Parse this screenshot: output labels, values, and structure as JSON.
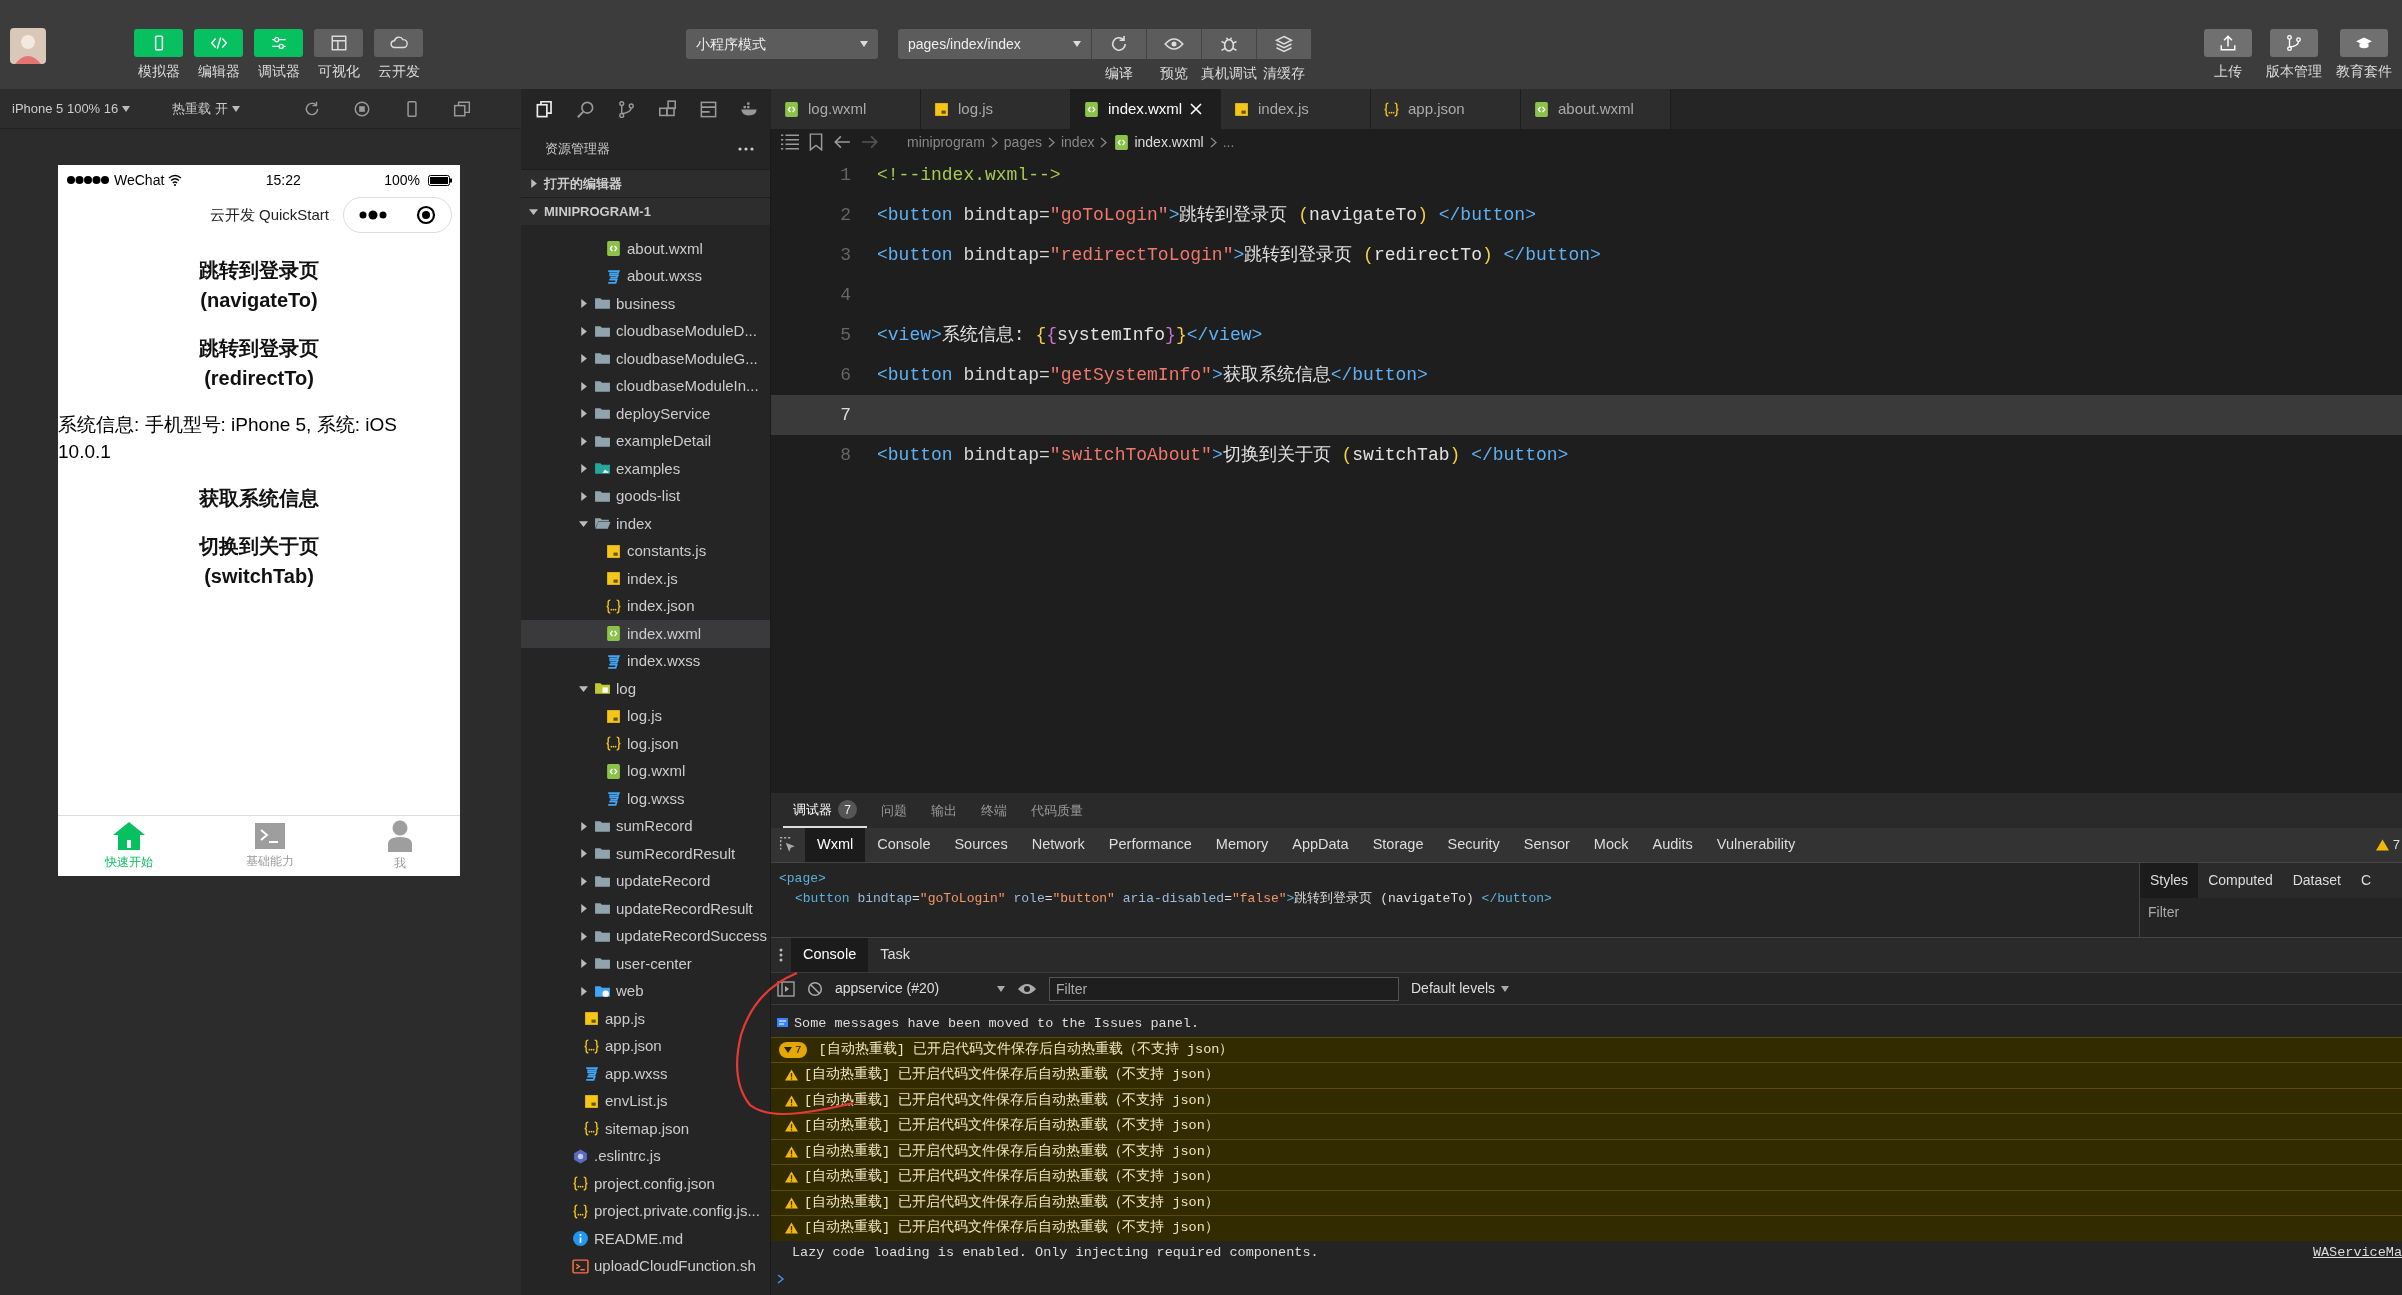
{
  "toolbar": {
    "view_buttons": [
      {
        "label": "模拟器",
        "on": true
      },
      {
        "label": "编辑器",
        "on": true
      },
      {
        "label": "调试器",
        "on": true
      },
      {
        "label": "可视化",
        "on": false
      },
      {
        "label": "云开发",
        "on": false
      }
    ],
    "mode_select": "小程序模式",
    "page_select": "pages/index/index",
    "action_buttons": [
      "编译",
      "预览",
      "真机调试",
      "清缓存"
    ],
    "right_buttons": [
      "上传",
      "版本管理",
      "教育套件"
    ]
  },
  "simulator_bar": {
    "device": "iPhone 5 100% 16",
    "hot_reload": "热重载 开"
  },
  "editor_tabs": [
    {
      "label": "log.wxml",
      "kind": "wxml",
      "selected": false
    },
    {
      "label": "log.js",
      "kind": "js",
      "selected": false
    },
    {
      "label": "index.wxml",
      "kind": "wxml",
      "selected": true
    },
    {
      "label": "index.js",
      "kind": "js",
      "selected": false
    },
    {
      "label": "app.json",
      "kind": "json",
      "selected": false
    },
    {
      "label": "about.wxml",
      "kind": "wxml",
      "selected": false
    }
  ],
  "breadcrumb": [
    {
      "label": "miniprogram",
      "kind": "dir"
    },
    {
      "label": "pages",
      "kind": "dir"
    },
    {
      "label": "index",
      "kind": "dir"
    },
    {
      "label": "index.wxml",
      "kind": "wxml"
    },
    {
      "label": "...",
      "kind": "dir"
    }
  ],
  "code": [
    {
      "number": "1",
      "current": false,
      "tokens": [
        {
          "kind": "comment",
          "text": "<!--index.wxml-->"
        }
      ]
    },
    {
      "number": "2",
      "current": false,
      "tokens": [
        {
          "kind": "tag",
          "text": "<button"
        },
        {
          "kind": "attr",
          "text": " bindtap="
        },
        {
          "kind": "string",
          "text": "\"goToLogin\""
        },
        {
          "kind": "tag",
          "text": ">"
        },
        {
          "kind": "text",
          "text": "跳转到登录页 "
        },
        {
          "kind": "paren",
          "text": "("
        },
        {
          "kind": "text",
          "text": "navigateTo"
        },
        {
          "kind": "paren",
          "text": ")"
        },
        {
          "kind": "tag",
          "text": " </button>"
        }
      ]
    },
    {
      "number": "3",
      "current": false,
      "tokens": [
        {
          "kind": "tag",
          "text": "<button"
        },
        {
          "kind": "attr",
          "text": " bindtap="
        },
        {
          "kind": "string",
          "text": "\"redirectToLogin\""
        },
        {
          "kind": "tag",
          "text": ">"
        },
        {
          "kind": "text",
          "text": "跳转到登录页 "
        },
        {
          "kind": "paren",
          "text": "("
        },
        {
          "kind": "text",
          "text": "redirectTo"
        },
        {
          "kind": "paren",
          "text": ")"
        },
        {
          "kind": "tag",
          "text": " </button>"
        }
      ]
    },
    {
      "number": "4",
      "current": false
    },
    {
      "number": "5",
      "current": false,
      "tokens": [
        {
          "kind": "tag",
          "text": "<view>"
        },
        {
          "kind": "text",
          "text": "系统信息: "
        },
        {
          "kind": "paren",
          "text": "{"
        },
        {
          "kind": "brace",
          "text": "{"
        },
        {
          "kind": "text",
          "text": "systemInfo"
        },
        {
          "kind": "brace",
          "text": "}"
        },
        {
          "kind": "paren",
          "text": "}"
        },
        {
          "kind": "tag",
          "text": "</view>"
        }
      ]
    },
    {
      "number": "6",
      "current": false,
      "tokens": [
        {
          "kind": "tag",
          "text": "<button"
        },
        {
          "kind": "attr",
          "text": " bindtap="
        },
        {
          "kind": "string",
          "text": "\"getSystemInfo\""
        },
        {
          "kind": "tag",
          "text": ">"
        },
        {
          "kind": "text",
          "text": "获取系统信息"
        },
        {
          "kind": "tag",
          "text": "</button>"
        }
      ]
    },
    {
      "number": "7",
      "current": true
    },
    {
      "number": "8",
      "current": false,
      "tokens": [
        {
          "kind": "tag",
          "text": "<button"
        },
        {
          "kind": "attr",
          "text": " bindtap="
        },
        {
          "kind": "string",
          "text": "\"switchToAbout\""
        },
        {
          "kind": "tag",
          "text": ">"
        },
        {
          "kind": "text",
          "text": "切换到关于页 "
        },
        {
          "kind": "paren",
          "text": "("
        },
        {
          "kind": "text",
          "text": "switchTab"
        },
        {
          "kind": "paren",
          "text": ")"
        },
        {
          "kind": "tag",
          "text": " </button>"
        }
      ]
    }
  ],
  "phone": {
    "carrier": "WeChat",
    "time": "15:22",
    "battery": "100%",
    "title": "云开发 QuickStart",
    "content": [
      {
        "kind": "button",
        "text": "跳转到登录页 (navigateTo)"
      },
      {
        "kind": "button",
        "text": "跳转到登录页 (redirectTo)"
      },
      {
        "kind": "text",
        "text": "系统信息: 手机型号: iPhone 5, 系统: iOS 10.0.1"
      },
      {
        "kind": "button",
        "text": "获取系统信息"
      },
      {
        "kind": "button",
        "text": "切换到关于页 (switchTab)"
      }
    ],
    "tabbar": [
      {
        "label": "快速开始",
        "selected": true
      },
      {
        "label": "基础能力",
        "selected": false
      },
      {
        "label": "我",
        "selected": false
      }
    ]
  },
  "explorer": {
    "title": "资源管理器",
    "sections": [
      {
        "label": "打开的编辑器",
        "expanded": false
      },
      {
        "label": "MINIPROGRAM-1",
        "expanded": true
      }
    ],
    "tree": [
      {
        "children": [
          {
            "children": [
              {
                "children": [
                  {
                    "label": "about.wxml",
                    "kind": "wxml",
                    "selected": false
                  },
                  {
                    "label": "about.wxss",
                    "kind": "wxss",
                    "selected": false
                  }
                ]
              },
              {
                "label": "business",
                "kind": "folder",
                "expanded": false,
                "selected": false
              },
              {
                "label": "cloudbaseModuleD...",
                "kind": "folder",
                "expanded": false,
                "selected": false
              },
              {
                "label": "cloudbaseModuleG...",
                "kind": "folder",
                "expanded": false,
                "selected": false
              },
              {
                "label": "cloudbaseModuleIn...",
                "kind": "folder",
                "expanded": false,
                "selected": false
              },
              {
                "label": "deployService",
                "kind": "folder",
                "expanded": false,
                "selected": false
              },
              {
                "label": "exampleDetail",
                "kind": "folder",
                "expanded": false,
                "selected": false
              },
              {
                "label": "examples",
                "kind": "folder-image",
                "expanded": false,
                "selected": false
              },
              {
                "label": "goods-list",
                "kind": "folder",
                "expanded": false,
                "selected": false
              },
              {
                "label": "index",
                "kind": "folder",
                "expanded": true,
                "selected": false,
                "children": [
                  {
                    "label": "constants.js",
                    "kind": "js",
                    "selected": false
                  },
                  {
                    "label": "index.js",
                    "kind": "js",
                    "selected": false
                  },
                  {
                    "label": "index.json",
                    "kind": "json",
                    "selected": false
                  },
                  {
                    "label": "index.wxml",
                    "kind": "wxml",
                    "selected": true
                  },
                  {
                    "label": "index.wxss",
                    "kind": "wxss",
                    "selected": false
                  }
                ]
              },
              {
                "label": "log",
                "kind": "folder-log",
                "expanded": true,
                "selected": false,
                "children": [
                  {
                    "label": "log.js",
                    "kind": "js",
                    "selected": false
                  },
                  {
                    "label": "log.json",
                    "kind": "json",
                    "selected": false
                  },
                  {
                    "label": "log.wxml",
                    "kind": "wxml",
                    "selected": false
                  },
                  {
                    "label": "log.wxss",
                    "kind": "wxss",
                    "selected": false
                  }
                ]
              },
              {
                "label": "sumRecord",
                "kind": "folder",
                "expanded": false,
                "selected": false
              },
              {
                "label": "sumRecordResult",
                "kind": "folder",
                "expanded": false,
                "selected": false
              },
              {
                "label": "updateRecord",
                "kind": "folder",
                "expanded": false,
                "selected": false
              },
              {
                "label": "updateRecordResult",
                "kind": "folder",
                "expanded": false,
                "selected": false
              },
              {
                "label": "updateRecordSuccess",
                "kind": "folder",
                "expanded": false,
                "selected": false
              },
              {
                "label": "user-center",
                "kind": "folder",
                "expanded": false,
                "selected": false
              },
              {
                "label": "web",
                "kind": "folder-web",
                "expanded": false,
                "selected": false
              }
            ]
          },
          {
            "label": "app.js",
            "kind": "js",
            "selected": false
          },
          {
            "label": "app.json",
            "kind": "json",
            "selected": false
          },
          {
            "label": "app.wxss",
            "kind": "wxss",
            "selected": false
          },
          {
            "label": "envList.js",
            "kind": "js",
            "selected": false
          },
          {
            "label": "sitemap.json",
            "kind": "json",
            "selected": false
          }
        ]
      },
      {
        "label": ".eslintrc.js",
        "kind": "eslint",
        "selected": false
      },
      {
        "label": "project.config.json",
        "kind": "json",
        "selected": false
      },
      {
        "label": "project.private.config.js...",
        "kind": "json",
        "selected": false
      },
      {
        "label": "README.md",
        "kind": "info",
        "selected": false
      },
      {
        "label": "uploadCloudFunction.sh",
        "kind": "shell",
        "selected": false
      }
    ]
  },
  "panel_tabs": [
    {
      "label": "调试器",
      "badge": "7",
      "selected": true
    },
    {
      "label": "问题",
      "selected": false
    },
    {
      "label": "输出",
      "selected": false
    },
    {
      "label": "终端",
      "selected": false
    },
    {
      "label": "代码质量",
      "selected": false
    }
  ],
  "devtools_tabs": [
    {
      "label": "Wxml",
      "selected": true
    },
    {
      "label": "Console",
      "selected": false
    },
    {
      "label": "Sources",
      "selected": false
    },
    {
      "label": "Network",
      "selected": false
    },
    {
      "label": "Performance",
      "selected": false
    },
    {
      "label": "Memory",
      "selected": false
    },
    {
      "label": "AppData",
      "selected": false
    },
    {
      "label": "Storage",
      "selected": false
    },
    {
      "label": "Security",
      "selected": false
    },
    {
      "label": "Sensor",
      "selected": false
    },
    {
      "label": "Mock",
      "selected": false
    },
    {
      "label": "Audits",
      "selected": false
    },
    {
      "label": "Vulnerability",
      "selected": false
    }
  ],
  "warning_count": "7",
  "wxml_lines": [
    {
      "tokens": [
        {
          "kind": "tag",
          "text": "<page>"
        }
      ]
    },
    {
      "tokens": [
        {
          "kind": "tag",
          "text": "<button"
        },
        {
          "kind": "attr",
          "text": " bindtap"
        },
        {
          "kind": "text",
          "text": "="
        },
        {
          "kind": "string",
          "text": "\"goToLogin\""
        },
        {
          "kind": "attr",
          "text": " role"
        },
        {
          "kind": "text",
          "text": "="
        },
        {
          "kind": "string",
          "text": "\"button\""
        },
        {
          "kind": "attr",
          "text": " aria-disabled"
        },
        {
          "kind": "text",
          "text": "="
        },
        {
          "kind": "string",
          "text": "\"false\""
        },
        {
          "kind": "tag",
          "text": ">"
        },
        {
          "kind": "text",
          "text": "跳转到登录页 (navigateTo) "
        },
        {
          "kind": "tag",
          "text": "</button>"
        }
      ]
    }
  ],
  "styles_tabs": [
    {
      "label": "Styles",
      "selected": true
    },
    {
      "label": "Computed",
      "selected": false
    },
    {
      "label": "Dataset",
      "selected": false
    },
    {
      "label": "C",
      "selected": false
    }
  ],
  "styles_filter": {
    "placeholder": "Filter"
  },
  "drawer_tabs": [
    {
      "label": "Console",
      "selected": true
    },
    {
      "label": "Task",
      "selected": false
    }
  ],
  "console_toolbar": {
    "context": "appservice (#20)",
    "filter": {
      "placeholder": "Filter"
    },
    "levels": "Default levels"
  },
  "messages": [
    {
      "kind": "info",
      "text": "Some messages have been moved to the Issues panel."
    },
    {
      "kind": "group",
      "count": "7",
      "expanded": true,
      "text": "[自动热重载] 已开启代码文件保存后自动热重载（不支持 json）"
    },
    {
      "kind": "warning",
      "text": "[自动热重载] 已开启代码文件保存后自动热重载（不支持 json）"
    },
    {
      "kind": "warning",
      "text": "[自动热重载] 已开启代码文件保存后自动热重载（不支持 json）"
    },
    {
      "kind": "warning",
      "text": "[自动热重载] 已开启代码文件保存后自动热重载（不支持 json）"
    },
    {
      "kind": "warning",
      "text": "[自动热重载] 已开启代码文件保存后自动热重载（不支持 json）"
    },
    {
      "kind": "warning",
      "text": "[自动热重载] 已开启代码文件保存后自动热重载（不支持 json）"
    },
    {
      "kind": "warning",
      "text": "[自动热重载] 已开启代码文件保存后自动热重载（不支持 json）"
    },
    {
      "kind": "warning",
      "text": "[自动热重载] 已开启代码文件保存后自动热重载（不支持 json）"
    },
    {
      "kind": "log",
      "text": "Lazy code loading is enabled. Only injecting required components.",
      "source": "WAServiceMa"
    }
  ]
}
